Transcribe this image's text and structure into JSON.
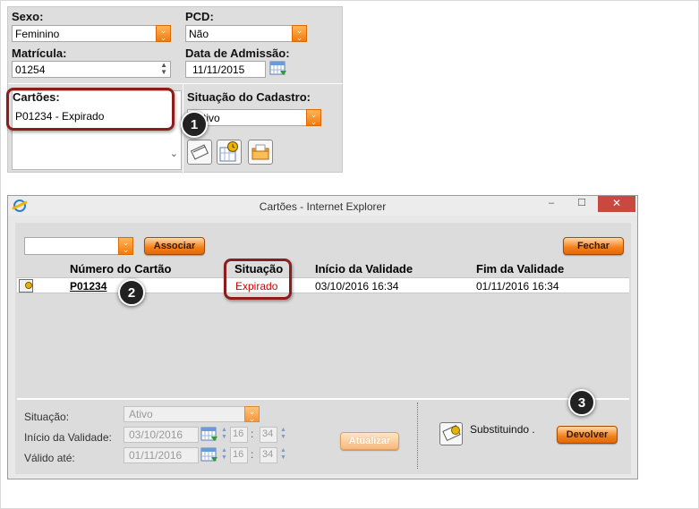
{
  "top_form": {
    "sexo": {
      "label": "Sexo:",
      "value": "Feminino"
    },
    "pcd": {
      "label": "PCD:",
      "value": "Não"
    },
    "matricula": {
      "label": "Matrícula:",
      "value": "01254"
    },
    "data_admissao": {
      "label": "Data de Admissão:",
      "value": "11/11/2015"
    },
    "cartoes": {
      "label": "Cartões:",
      "items": [
        "P01234 - Expirado"
      ]
    },
    "situacao_cadastro": {
      "label": "Situação do Cadastro:",
      "value": "Ativo"
    }
  },
  "callouts": {
    "one": "1",
    "two": "2",
    "three": "3"
  },
  "window": {
    "title": "Cartões - Internet Explorer",
    "controls": {
      "minimize": "–",
      "maximize": "☐",
      "close": "✕"
    }
  },
  "toolbar": {
    "associar_label": "Associar",
    "fechar_label": "Fechar",
    "select_value": ""
  },
  "table": {
    "headers": [
      "Número do Cartão",
      "Situação",
      "Início da Validade",
      "Fim da Validade"
    ],
    "rows": [
      {
        "numero": "P01234",
        "situacao": "Expirado",
        "inicio": "03/10/2016 16:34",
        "fim": "01/11/2016 16:34"
      }
    ]
  },
  "detail": {
    "situacao_label": "Situação:",
    "situacao_value": "Ativo",
    "inicio_label": "Início da Validade:",
    "inicio_date": "03/10/2016",
    "inicio_hour": "16",
    "inicio_min": "34",
    "valido_label": "Válido até:",
    "valido_date": "01/11/2016",
    "valido_hour": "16",
    "valido_min": "34",
    "atualizar_label": "Atualizar",
    "substituindo_text": "Substituindo .",
    "devolver_label": "Devolver"
  },
  "colors": {
    "accent_orange": "#f47f1a",
    "highlight_red": "#8c1d1d",
    "status_red": "#d40000"
  }
}
